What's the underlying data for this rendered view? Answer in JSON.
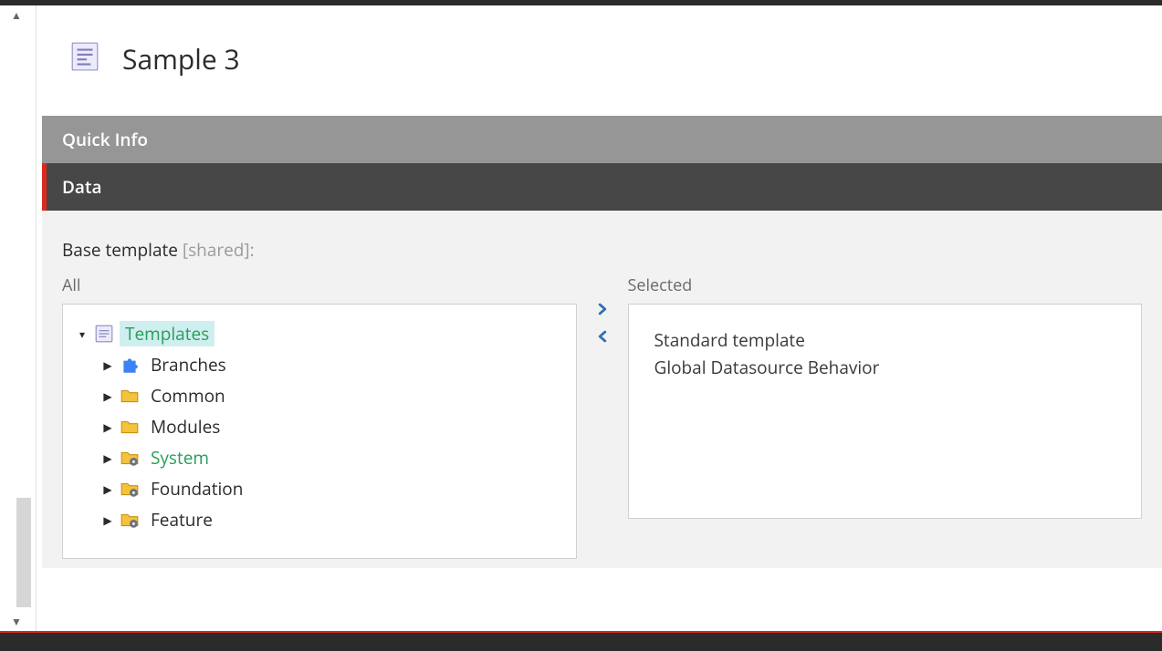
{
  "header": {
    "title": "Sample 3"
  },
  "sections": {
    "quick_info": "Quick Info",
    "data": "Data"
  },
  "field": {
    "label": "Base template",
    "shared_label": " [shared]:"
  },
  "cols": {
    "all": "All",
    "selected": "Selected"
  },
  "tree": {
    "root": {
      "label": "Templates"
    },
    "children": {
      "branches": "Branches",
      "common": "Common",
      "modules": "Modules",
      "system": "System",
      "foundation": "Foundation",
      "feature": "Feature"
    }
  },
  "selected": {
    "item1": "Standard template",
    "item2": "Global Datasource Behavior"
  }
}
